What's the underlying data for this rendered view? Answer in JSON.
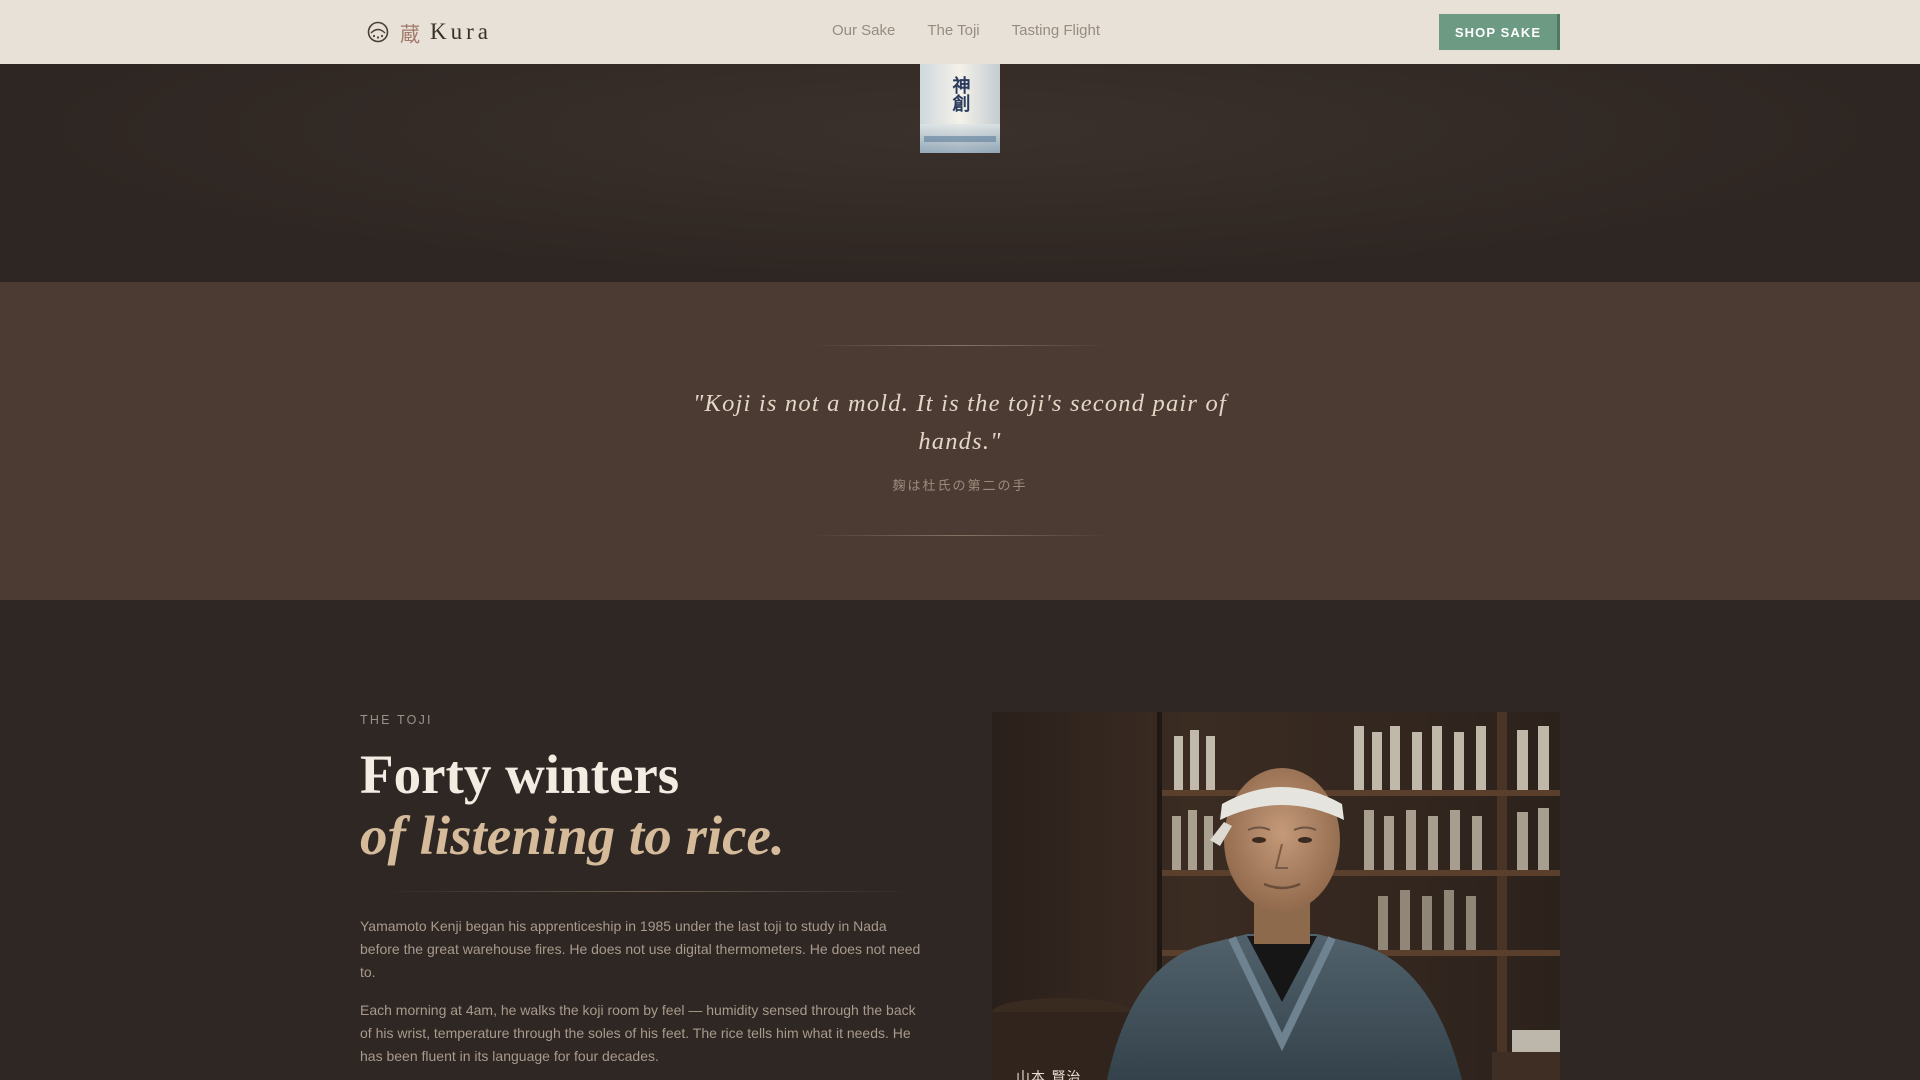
{
  "header": {
    "logo_kanji": "蔵",
    "logo_word": "Kura",
    "nav": [
      "Our Sake",
      "The Toji",
      "Tasting Flight"
    ],
    "cta_label": "SHOP SAKE"
  },
  "hero": {
    "bottle_label": "神創"
  },
  "quote": {
    "text": "\"Koji is not a mold. It is the toji's second pair of hands.\"",
    "japanese": "麹は杜氏の第二の手"
  },
  "toji": {
    "eyebrow": "THE TOJI",
    "headline": "Forty winters",
    "headline_italic": "of listening to rice.",
    "paragraphs": [
      "Yamamoto Kenji began his apprenticeship in 1985 under the last toji to study in Nada before the great warehouse fires. He does not use digital thermometers. He does not need to.",
      "Each morning at 4am, he walks the koji room by feel — humidity sensed through the back of his wrist, temperature through the soles of his feet. The rice tells him what it needs. He has been fluent in its language for four decades."
    ],
    "portrait_caption": "山本 賢治"
  },
  "colors": {
    "header_bg": "#e7e1d8",
    "cta_green": "#6c9a82",
    "quote_band": "#4b3b32",
    "page_bg": "#2f2724",
    "accent_tan": "#d6bb9a"
  }
}
